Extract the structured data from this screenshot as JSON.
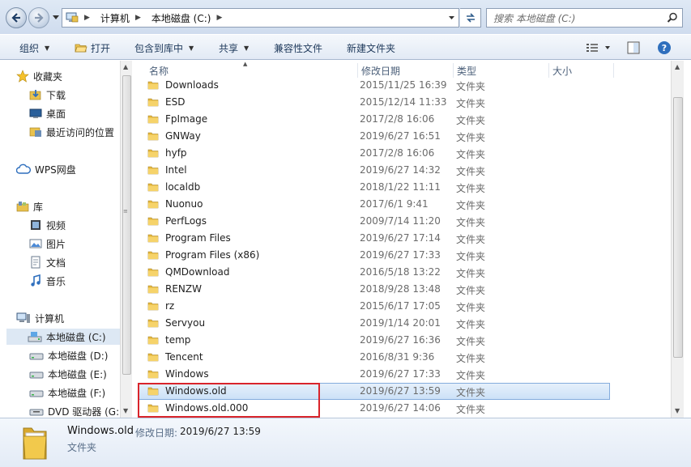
{
  "address_bar": {
    "crumbs": [
      "计算机",
      "本地磁盘 (C:)"
    ],
    "search_placeholder": "搜索 本地磁盘 (C:)"
  },
  "toolbar": {
    "organize": "组织",
    "open": "打开",
    "include_in_library": "包含到库中",
    "share": "共享",
    "compat_files": "兼容性文件",
    "new_folder": "新建文件夹"
  },
  "nav": {
    "favorites": "收藏夹",
    "downloads": "下载",
    "desktop": "桌面",
    "recent": "最近访问的位置",
    "wps": "WPS网盘",
    "libraries": "库",
    "videos": "视频",
    "pictures": "图片",
    "documents": "文档",
    "music": "音乐",
    "computer": "计算机",
    "drive_c": "本地磁盘 (C:)",
    "drive_d": "本地磁盘 (D:)",
    "drive_e": "本地磁盘 (E:)",
    "drive_f": "本地磁盘 (F:)",
    "drive_g": "DVD 驱动器 (G:)"
  },
  "columns": {
    "name": "名称",
    "date": "修改日期",
    "type": "类型",
    "size": "大小"
  },
  "files": [
    {
      "name": "Downloads",
      "date": "2015/11/25 16:39",
      "type": "文件夹"
    },
    {
      "name": "ESD",
      "date": "2015/12/14 11:33",
      "type": "文件夹"
    },
    {
      "name": "FpImage",
      "date": "2017/2/8 16:06",
      "type": "文件夹"
    },
    {
      "name": "GNWay",
      "date": "2019/6/27 16:51",
      "type": "文件夹"
    },
    {
      "name": "hyfp",
      "date": "2017/2/8 16:06",
      "type": "文件夹"
    },
    {
      "name": "Intel",
      "date": "2019/6/27 14:32",
      "type": "文件夹"
    },
    {
      "name": "localdb",
      "date": "2018/1/22 11:11",
      "type": "文件夹"
    },
    {
      "name": "Nuonuo",
      "date": "2017/6/1 9:41",
      "type": "文件夹"
    },
    {
      "name": "PerfLogs",
      "date": "2009/7/14 11:20",
      "type": "文件夹"
    },
    {
      "name": "Program Files",
      "date": "2019/6/27 17:14",
      "type": "文件夹"
    },
    {
      "name": "Program Files (x86)",
      "date": "2019/6/27 17:33",
      "type": "文件夹"
    },
    {
      "name": "QMDownload",
      "date": "2016/5/18 13:22",
      "type": "文件夹"
    },
    {
      "name": "RENZW",
      "date": "2018/9/28 13:48",
      "type": "文件夹"
    },
    {
      "name": "rz",
      "date": "2015/6/17 17:05",
      "type": "文件夹"
    },
    {
      "name": "Servyou",
      "date": "2019/1/14 20:01",
      "type": "文件夹"
    },
    {
      "name": "temp",
      "date": "2019/6/27 16:36",
      "type": "文件夹"
    },
    {
      "name": "Tencent",
      "date": "2016/8/31 9:36",
      "type": "文件夹"
    },
    {
      "name": "Windows",
      "date": "2019/6/27 17:33",
      "type": "文件夹"
    },
    {
      "name": "Windows.old",
      "date": "2019/6/27 13:59",
      "type": "文件夹"
    },
    {
      "name": "Windows.old.000",
      "date": "2019/6/27 14:06",
      "type": "文件夹"
    }
  ],
  "selected_index": 18,
  "details": {
    "name": "Windows.old",
    "date_label": "修改日期:",
    "date_value": "2019/6/27 13:59",
    "type": "文件夹"
  },
  "colors": {
    "highlight_border": "#d9242b",
    "selection_bg": "#cce1f7",
    "folder_yellow": "#f2c94c"
  }
}
